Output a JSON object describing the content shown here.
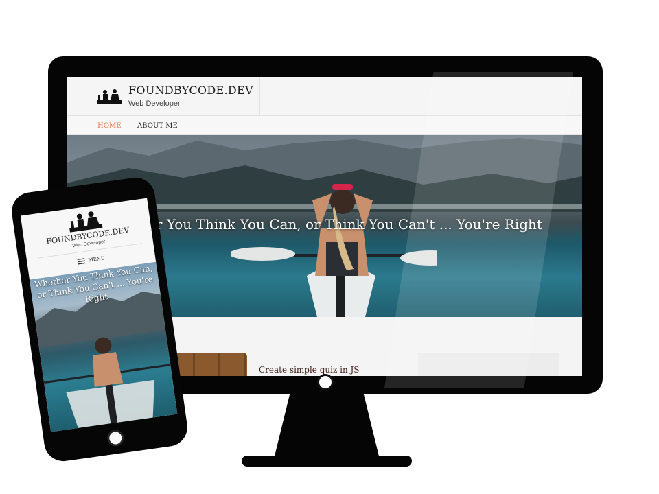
{
  "site": {
    "title": "FOUNDBYCODE.DEV",
    "tagline": "Web Developer",
    "nav": [
      {
        "label": "HOME",
        "active": true
      },
      {
        "label": "ABOUT ME",
        "active": false
      }
    ],
    "hero_quote_visible": "er You Think You Can, or Think You Can't ... You're Right",
    "post_title": "Create simple quiz in JS"
  },
  "mobile": {
    "title": "FOUNDBYCODE.DEV",
    "tagline": "Web Developer",
    "menu_label": "MENU",
    "hero_quote": "Whether You Think You Can, or Think You Can't ... You're Right"
  },
  "colors": {
    "accent_nav_active": "#e8734a",
    "device_frame": "#050505",
    "post_title": "#3a1d16"
  },
  "icons": [
    "logo-figures-icon",
    "hamburger-menu-icon"
  ]
}
